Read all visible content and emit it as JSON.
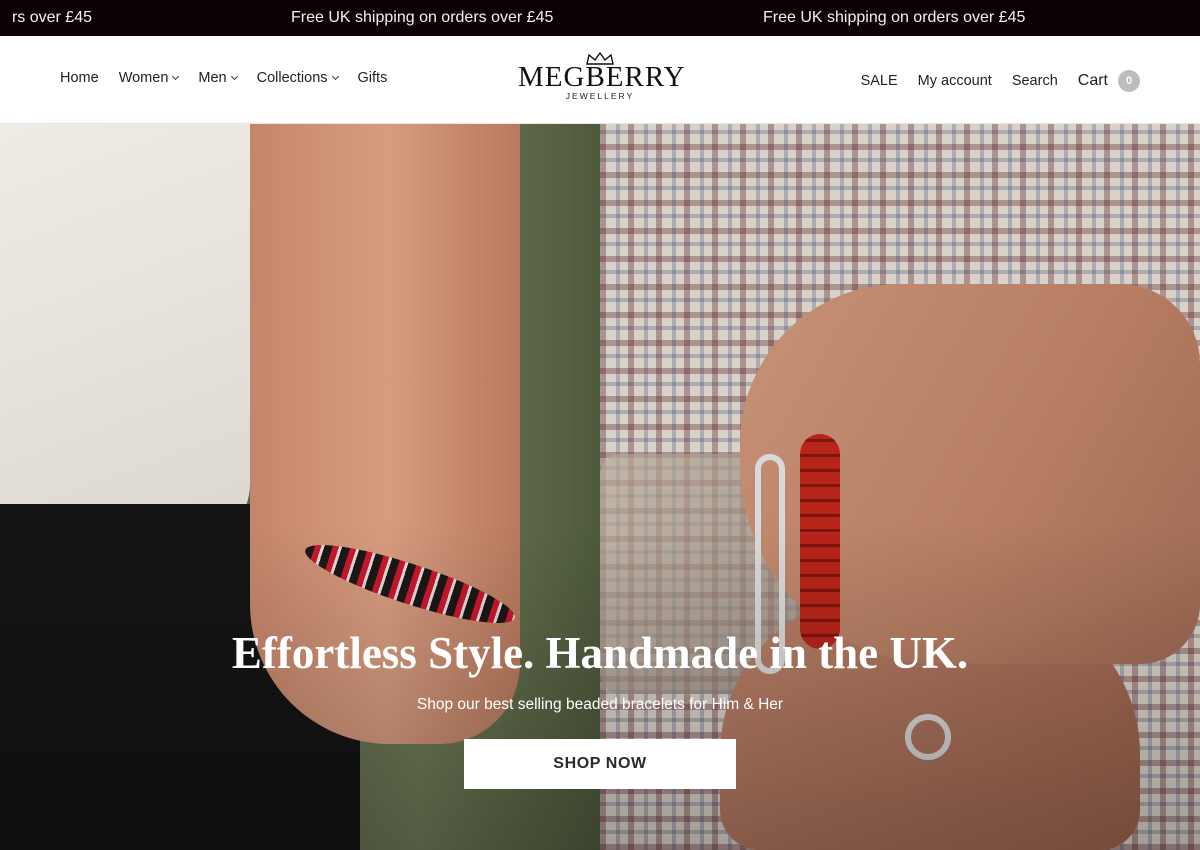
{
  "announcement": {
    "items": [
      "rs over £45",
      "Free UK shipping on orders over £45",
      "Free UK shipping on orders over £45"
    ]
  },
  "header": {
    "nav_left": [
      {
        "label": "Home",
        "has_dropdown": false
      },
      {
        "label": "Women",
        "has_dropdown": true
      },
      {
        "label": "Men",
        "has_dropdown": true
      },
      {
        "label": "Collections",
        "has_dropdown": true
      },
      {
        "label": "Gifts",
        "has_dropdown": false
      }
    ],
    "logo": {
      "brand": "MEGBERRY",
      "sub": "JEWELLERY",
      "icon": "crown-icon"
    },
    "nav_right": {
      "sale": "SALE",
      "account": "My account",
      "search": "Search",
      "cart_label": "Cart",
      "cart_count": "0"
    }
  },
  "hero": {
    "headline": "Effortless Style. Handmade in the UK.",
    "subline": "Shop our best selling beaded bracelets for Him & Her",
    "cta_label": "SHOP NOW"
  },
  "colors": {
    "announcement_bg": "#0c0203",
    "announcement_text": "#f2f2f2",
    "cart_badge": "#bdbdbd",
    "cta_bg": "#ffffff",
    "cta_text": "#2a2a2a"
  }
}
